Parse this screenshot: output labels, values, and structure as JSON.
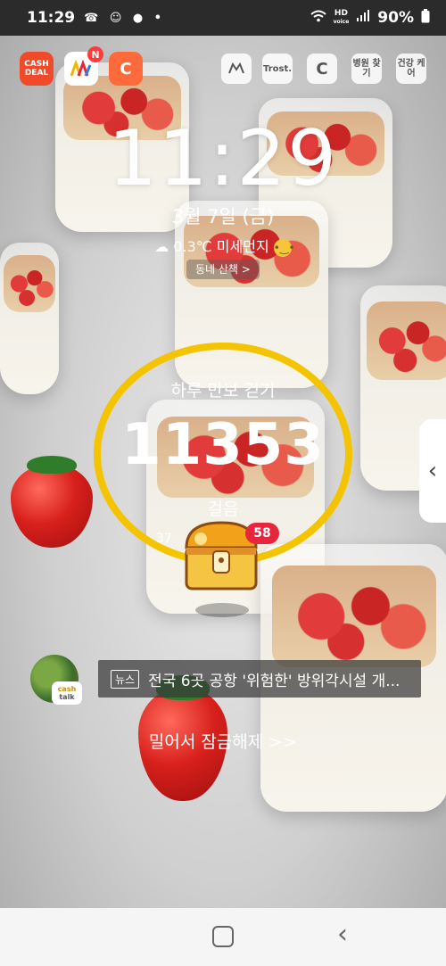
{
  "status_bar": {
    "time": "11:29",
    "left_icons": "☎ ☺ ● •",
    "hd_top": "HD",
    "hd_bottom": "voice",
    "battery": "90%"
  },
  "shortcuts": {
    "cash_deal": "CASH DEAL",
    "badge": "N",
    "paw": "C",
    "trost": "Trost.",
    "c_app": "C",
    "hospital": "병원 찾기",
    "health": "건강 케어"
  },
  "lockscreen": {
    "time": "11:29",
    "date": "3월 7일 (금)",
    "weather": "0.3℃ 미세먼지",
    "walk_chip": "동네 산책 >"
  },
  "steps": {
    "title": "하루 만보 걷기",
    "count": "11353",
    "unit": "걸음",
    "sub": "37",
    "chest_badge": "58",
    "progress": 1.0
  },
  "news": {
    "cashtalk_line1": "cash",
    "cashtalk_line2": "talk",
    "tag": "뉴스",
    "headline": "전국 6곳 공항 '위험한' 방위각시설 개..."
  },
  "unlock_text": "밀어서 잠금해제 >>",
  "colors": {
    "ring": "#f5c400",
    "accent_red": "#e8253f"
  }
}
